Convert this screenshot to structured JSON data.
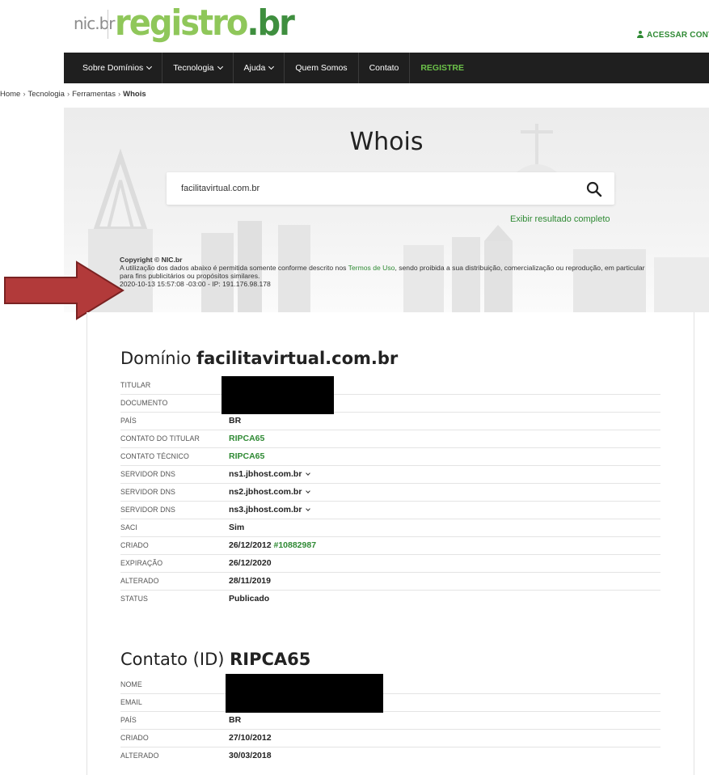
{
  "header": {
    "logo_nic": "nic.br",
    "logo_registro": "registro",
    "logo_tld": ".br",
    "access_link": "ACESSAR CONT"
  },
  "nav": {
    "items": [
      "Sobre Domínios",
      "Tecnologia",
      "Ajuda",
      "Quem Somos",
      "Contato",
      "REGISTRE"
    ]
  },
  "breadcrumb": {
    "items": [
      "Home",
      "Tecnologia",
      "Ferramentas"
    ],
    "current": "Whois",
    "separator": "›"
  },
  "hero": {
    "title": "Whois",
    "search_value": "facilitavirtual.com.br",
    "full_result_link": "Exibir resultado completo"
  },
  "copyright": {
    "title": "Copyright © NIC.br",
    "text_before": "A utilização dos dados abaixo é permitida somente conforme descrito nos ",
    "terms_link": "Termos de Uso",
    "text_after": ", sendo proibida a sua distribuição, comercialização ou reprodução, em particular para fins publicitários ou propósitos similares.",
    "timestamp": "2020-10-13 15:57:08 -03:00 - IP: 191.176.98.178"
  },
  "domain": {
    "title_prefix": "Domínio",
    "domain_name": "facilitavirtual.com.br",
    "rows": {
      "titular": {
        "label": "TITULAR"
      },
      "documento": {
        "label": "DOCUMENTO"
      },
      "pais": {
        "label": "PAÍS",
        "value": "BR"
      },
      "contato_titular": {
        "label": "CONTATO DO TITULAR",
        "value": "RIPCA65"
      },
      "contato_tecnico": {
        "label": "CONTATO TÉCNICO",
        "value": "RIPCA65"
      },
      "dns1": {
        "label": "SERVIDOR DNS",
        "value": "ns1.jbhost.com.br"
      },
      "dns2": {
        "label": "SERVIDOR DNS",
        "value": "ns2.jbhost.com.br"
      },
      "dns3": {
        "label": "SERVIDOR DNS",
        "value": "ns3.jbhost.com.br"
      },
      "saci": {
        "label": "SACI",
        "value": "Sim"
      },
      "criado": {
        "label": "CRIADO",
        "value": "26/12/2012",
        "ticket": "#10882987"
      },
      "expiracao": {
        "label": "EXPIRAÇÃO",
        "value": "26/12/2020"
      },
      "alterado": {
        "label": "ALTERADO",
        "value": "28/11/2019"
      },
      "status": {
        "label": "STATUS",
        "value": "Publicado"
      }
    }
  },
  "contact": {
    "title_prefix": "Contato (ID)",
    "contact_id": "RIPCA65",
    "rows": {
      "nome": {
        "label": "NOME"
      },
      "email": {
        "label": "EMAIL"
      },
      "pais": {
        "label": "PAÍS",
        "value": "BR"
      },
      "criado": {
        "label": "CRIADO",
        "value": "27/10/2012"
      },
      "alterado": {
        "label": "ALTERADO",
        "value": "30/03/2018"
      }
    }
  },
  "colors": {
    "brand_green": "#2f8a34",
    "logo_light_green": "#8fc75a",
    "nav_bg": "#1f1f1f",
    "arrow_red": "#b23a3a"
  }
}
